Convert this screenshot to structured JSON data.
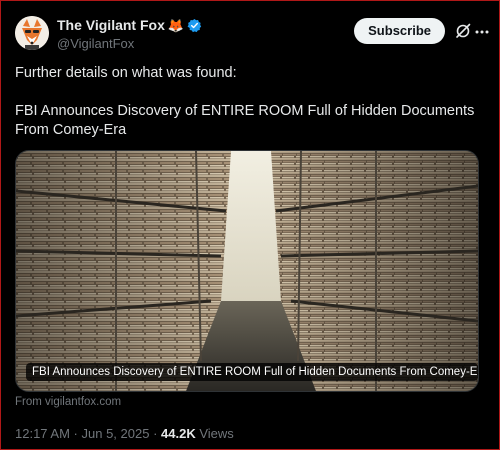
{
  "author": {
    "display_name": "The Vigilant Fox",
    "emoji": "🦊",
    "handle": "@VigilantFox",
    "verified_color": "#1d9bf0"
  },
  "actions": {
    "subscribe_label": "Subscribe",
    "grok_icon": "grok-slash-icon",
    "more_icon": "more-dots-icon"
  },
  "post": {
    "line1": "Further details on what was found:",
    "line2": "FBI Announces Discovery of ENTIRE ROOM Full of Hidden Documents From Comey-Era"
  },
  "card": {
    "title": "FBI Announces Discovery of ENTIRE ROOM Full of Hidden Documents From Comey-Era",
    "source": "From vigilantfox.com"
  },
  "meta": {
    "time": "12:17 AM",
    "sep1": " · ",
    "date": "Jun 5, 2025",
    "sep2": " · ",
    "views_count": "44.2K",
    "views_label": " Views"
  }
}
